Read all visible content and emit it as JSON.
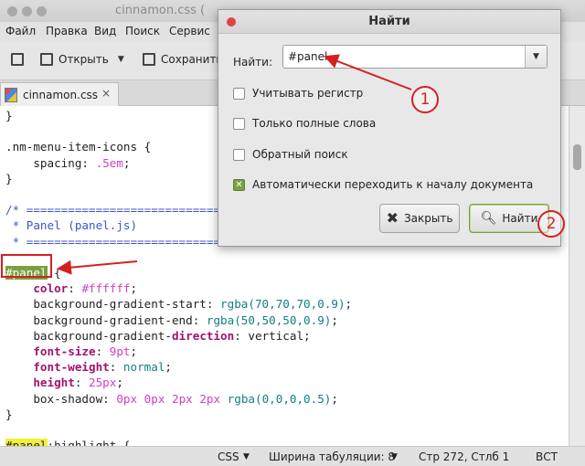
{
  "window": {
    "title": "cinnamon.css (",
    "menu": [
      "Файл",
      "Правка",
      "Вид",
      "Поиск",
      "Сервис"
    ]
  },
  "toolbar": {
    "open_label": "Открыть",
    "save_label": "Сохранить"
  },
  "tab": {
    "label": "cinnamon.css",
    "close": "×"
  },
  "editor_lines": [
    [
      {
        "t": "}",
        "c": "c-plain"
      }
    ],
    [],
    [
      {
        "t": ".nm-menu-item-icons {",
        "c": "c-plain"
      }
    ],
    [
      {
        "t": "    spacing: ",
        "c": "c-plain"
      },
      {
        "t": ".5em",
        "c": "c-num"
      },
      {
        "t": ";",
        "c": "c-plain"
      }
    ],
    [
      {
        "t": "}",
        "c": "c-plain"
      }
    ],
    [],
    [
      {
        "t": "/* ==============================",
        "c": "c-comment"
      }
    ],
    [
      {
        "t": " * Panel (panel.js)",
        "c": "c-comment"
      }
    ],
    [
      {
        "t": " * ==============================",
        "c": "c-comment"
      }
    ],
    [],
    [
      {
        "t": "#panel",
        "c": "hl-sel"
      },
      {
        "t": " {",
        "c": "c-plain"
      }
    ],
    [
      {
        "t": "    ",
        "c": "c-plain"
      },
      {
        "t": "color",
        "c": "c-kw"
      },
      {
        "t": ": ",
        "c": "c-plain"
      },
      {
        "t": "#ffffff",
        "c": "c-num"
      },
      {
        "t": ";",
        "c": "c-plain"
      }
    ],
    [
      {
        "t": "    background-gradient-start: ",
        "c": "c-plain"
      },
      {
        "t": "rgba(70,70,70,0.9)",
        "c": "c-val"
      },
      {
        "t": ";",
        "c": "c-plain"
      }
    ],
    [
      {
        "t": "    background-gradient-end: ",
        "c": "c-plain"
      },
      {
        "t": "rgba(50,50,50,0.9)",
        "c": "c-val"
      },
      {
        "t": ";",
        "c": "c-plain"
      }
    ],
    [
      {
        "t": "    background-gradient-",
        "c": "c-plain"
      },
      {
        "t": "direction",
        "c": "c-kw"
      },
      {
        "t": ": vertical;",
        "c": "c-plain"
      }
    ],
    [
      {
        "t": "    ",
        "c": "c-plain"
      },
      {
        "t": "font-size",
        "c": "c-kw"
      },
      {
        "t": ": ",
        "c": "c-plain"
      },
      {
        "t": "9pt",
        "c": "c-num"
      },
      {
        "t": ";",
        "c": "c-plain"
      }
    ],
    [
      {
        "t": "    ",
        "c": "c-plain"
      },
      {
        "t": "font-weight",
        "c": "c-kw"
      },
      {
        "t": ": ",
        "c": "c-plain"
      },
      {
        "t": "normal",
        "c": "c-val"
      },
      {
        "t": ";",
        "c": "c-plain"
      }
    ],
    [
      {
        "t": "    ",
        "c": "c-plain"
      },
      {
        "t": "height",
        "c": "c-kw"
      },
      {
        "t": ": ",
        "c": "c-plain"
      },
      {
        "t": "25px",
        "c": "c-num"
      },
      {
        "t": ";",
        "c": "c-plain"
      }
    ],
    [
      {
        "t": "    box-shadow: ",
        "c": "c-plain"
      },
      {
        "t": "0px 0px 2px 2px ",
        "c": "c-num"
      },
      {
        "t": "rgba(0,0,0,0.5)",
        "c": "c-val"
      },
      {
        "t": ";",
        "c": "c-plain"
      }
    ],
    [
      {
        "t": "}",
        "c": "c-plain"
      }
    ],
    [],
    [
      {
        "t": "#panel",
        "c": "hl-yellow"
      },
      {
        "t": ":highlight {",
        "c": "c-plain"
      }
    ]
  ],
  "status": {
    "language": "CSS",
    "tab_width": "Ширина табуляции: 8",
    "position": "Стр 272, Стлб 1",
    "mode": "ВСТ"
  },
  "dialog": {
    "title": "Найти",
    "find_label": "Найти:",
    "find_value": "#panel",
    "options": [
      {
        "label": "Учитывать регистр",
        "checked": false
      },
      {
        "label": "Только полные слова",
        "checked": false
      },
      {
        "label": "Обратный поиск",
        "checked": false
      },
      {
        "label": "Автоматически переходить к началу документа",
        "checked": true
      }
    ],
    "close_button": "Закрыть",
    "find_button": "Найти"
  },
  "annotations": {
    "marker1": "1",
    "marker2": "2",
    "color": "#d42020"
  },
  "colors": {
    "selection": "#79a042",
    "search_highlight": "#f1f13a"
  }
}
